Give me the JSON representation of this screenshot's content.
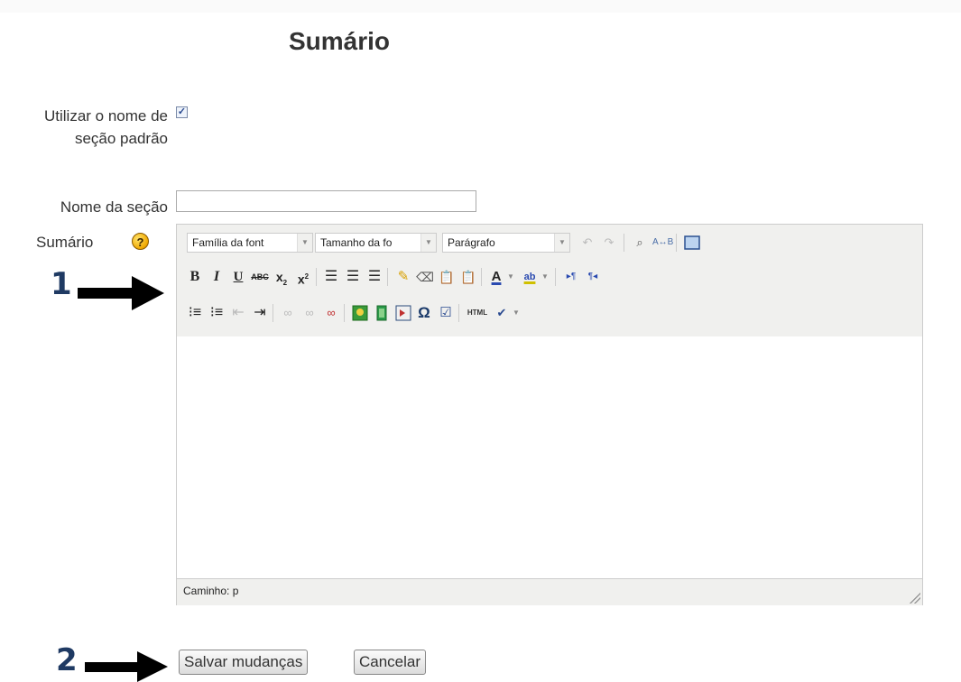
{
  "page": {
    "title": "Sumário"
  },
  "form": {
    "use_default_label": "Utilizar o nome de seção padrão",
    "use_default_checked": true,
    "section_name_label": "Nome da seção",
    "section_name_value": "",
    "summary_label": "Sumário",
    "help_glyph": "?"
  },
  "editor": {
    "selects": {
      "font_family": "Família da font",
      "font_size": "Tamanho da fo",
      "format": "Parágrafo"
    },
    "path_text": "Caminho: p",
    "html_button_label": "HTML"
  },
  "callouts": {
    "one": "1",
    "two": "2"
  },
  "actions": {
    "save": "Salvar mudanças",
    "cancel": "Cancelar"
  },
  "colors": {
    "accent_arrow": "#000000",
    "callout_number": "#1f3a63",
    "toolbar_bg": "#f0f0ee"
  }
}
